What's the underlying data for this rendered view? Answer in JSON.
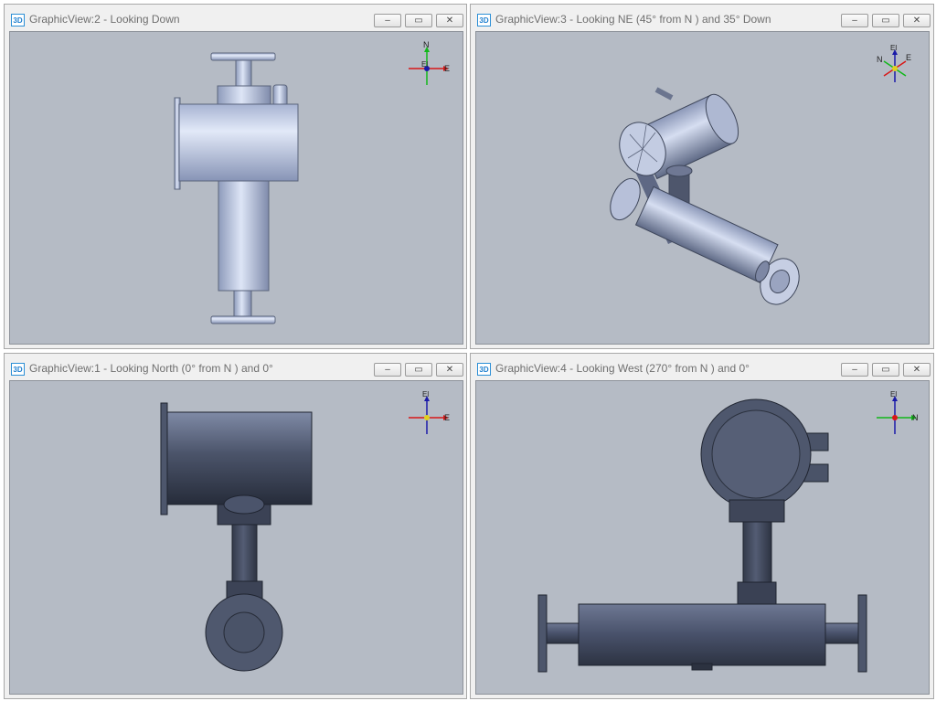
{
  "views": [
    {
      "icon": "3D",
      "title": "GraphicView:2 - Looking Down",
      "compass": [
        "N",
        "El",
        "E"
      ]
    },
    {
      "icon": "3D",
      "title": "GraphicView:3 - Looking NE (45° from N ) and 35° Down",
      "compass": [
        "El",
        "N",
        "E"
      ]
    },
    {
      "icon": "3D",
      "title": "GraphicView:1 - Looking North (0° from N ) and 0°",
      "compass": [
        "El",
        "E"
      ]
    },
    {
      "icon": "3D",
      "title": "GraphicView:4 - Looking West (270° from N ) and 0°",
      "compass": [
        "El",
        "N"
      ]
    }
  ],
  "window_buttons": {
    "minimize": "–",
    "maximize": "▭",
    "close": "✕"
  },
  "colors": {
    "viewport_bg": "#b5bbc5",
    "model_light": "#c7d2ec",
    "model_dark": "#4a5266"
  }
}
